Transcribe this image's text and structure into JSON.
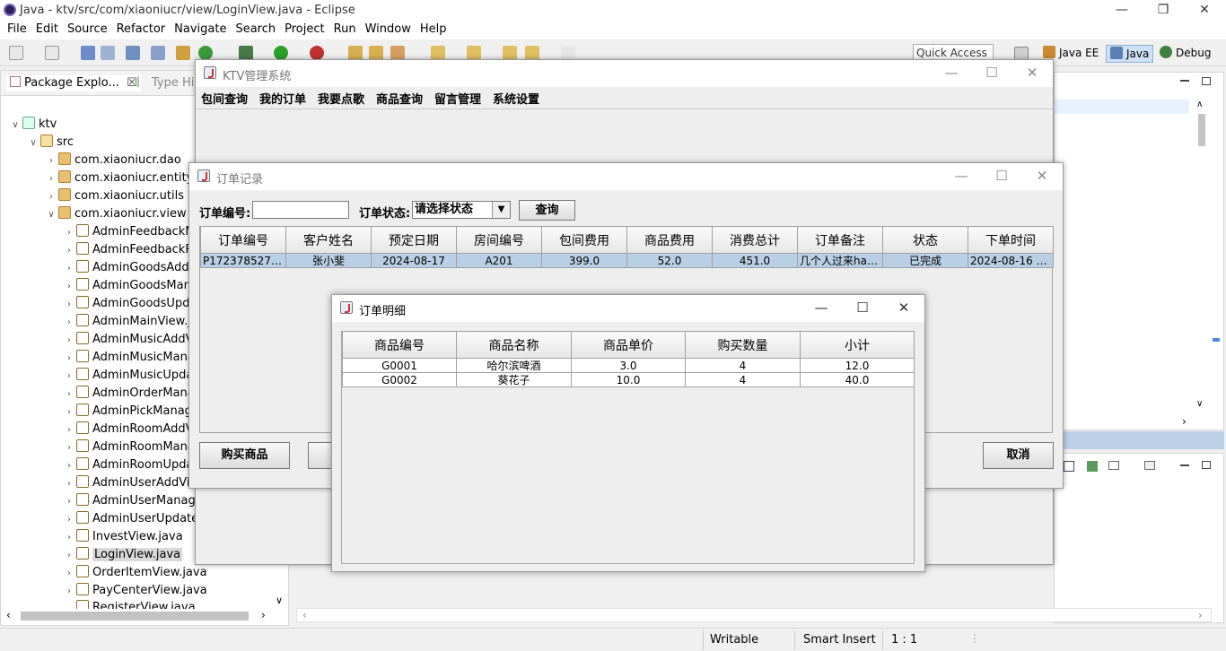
{
  "eclipse": {
    "title": "Java - ktv/src/com/xiaoniucr/view/LoginView.java - Eclipse",
    "menu": [
      "File",
      "Edit",
      "Source",
      "Refactor",
      "Navigate",
      "Search",
      "Project",
      "Run",
      "Window",
      "Help"
    ],
    "quick_access": "Quick Access",
    "perspectives": [
      "Java EE",
      "Java",
      "Debug"
    ]
  },
  "explorer": {
    "tab_label": "Package Explo...",
    "tab2_label": "Type Hie",
    "project": "ktv",
    "src": "src",
    "packages": [
      "com.xiaoniucr.dao",
      "com.xiaoniucr.entity",
      "com.xiaoniucr.utils",
      "com.xiaoniucr.view"
    ],
    "files": [
      "AdminFeedbackM",
      "AdminFeedbackRe",
      "AdminGoodsAddV",
      "AdminGoodsMana",
      "AdminGoodsUpda",
      "AdminMainView.ja",
      "AdminMusicAddVi",
      "AdminMusicMana",
      "AdminMusicUpdat",
      "AdminOrderMana",
      "AdminPickManage",
      "AdminRoomAddV",
      "AdminRoomMana",
      "AdminRoomUpda",
      "AdminUserAddVie",
      "AdminUserManage",
      "AdminUserUpdateV",
      "InvestView.java",
      "LoginView.java",
      "OrderItemView.java",
      "PayCenterView.java",
      "RegisterView.java"
    ]
  },
  "status": {
    "writable": "Writable",
    "insert": "Smart Insert",
    "position": "1 : 1"
  },
  "ktv_window": {
    "title": "KTV管理系统",
    "menu": [
      "包间查询",
      "我的订单",
      "我要点歌",
      "商品查询",
      "留言管理",
      "系统设置"
    ]
  },
  "order_window": {
    "title": "订单记录",
    "order_no_label": "订单编号:",
    "order_no_value": "",
    "status_label": "订单状态:",
    "status_selected": "请选择状态",
    "query_button": "查询",
    "columns": [
      "订单编号",
      "客户姓名",
      "预定日期",
      "房间编号",
      "包间费用",
      "商品费用",
      "消费总计",
      "订单备注",
      "状态",
      "下单时间"
    ],
    "rows": [
      [
        "P1723785273...",
        "张小斐",
        "2024-08-17",
        "A201",
        "399.0",
        "52.0",
        "451.0",
        "几个人过来hap...",
        "已完成",
        "2024-08-16 13..."
      ]
    ],
    "buy_button": "购买商品",
    "cancel_button": "取消"
  },
  "detail_window": {
    "title": "订单明细",
    "columns": [
      "商品编号",
      "商品名称",
      "商品单价",
      "购买数量",
      "小计"
    ],
    "rows": [
      [
        "G0001",
        "哈尔滨啤酒",
        "3.0",
        "4",
        "12.0"
      ],
      [
        "G0002",
        "葵花子",
        "10.0",
        "4",
        "40.0"
      ]
    ]
  }
}
